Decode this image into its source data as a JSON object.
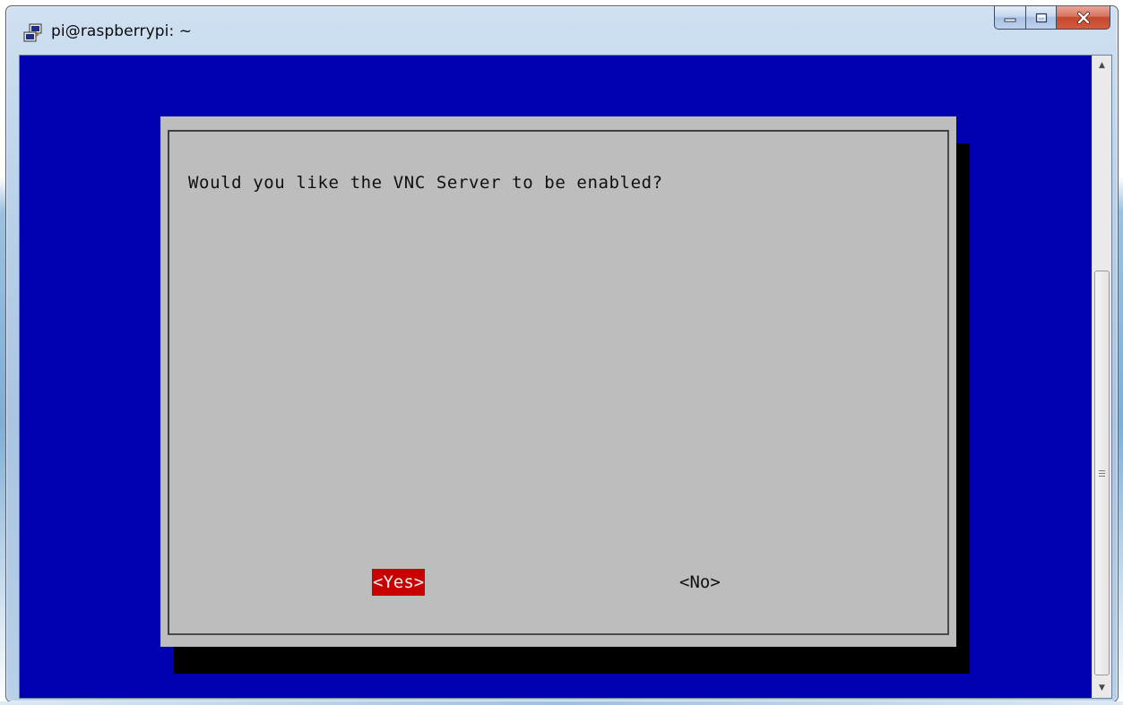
{
  "window": {
    "title": "pi@raspberrypi: ~",
    "icon": "putty-icon",
    "controls": {
      "minimize": "minimize-icon",
      "maximize": "maximize-icon",
      "close": "close-icon"
    }
  },
  "colors": {
    "terminal_background": "#0000b0",
    "dialog_background": "#bdbdbd",
    "dialog_shadow": "#000000",
    "selected_button": "#c80000",
    "selected_button_text": "#f1f1f1",
    "text": "#101010"
  },
  "dialog": {
    "prompt": "Would you like the VNC Server to be enabled?",
    "buttons": {
      "yes": "<Yes>",
      "no": "<No>"
    },
    "selected": "yes"
  },
  "scrollbar": {
    "up_arrow": "▲",
    "down_arrow": "▼"
  }
}
